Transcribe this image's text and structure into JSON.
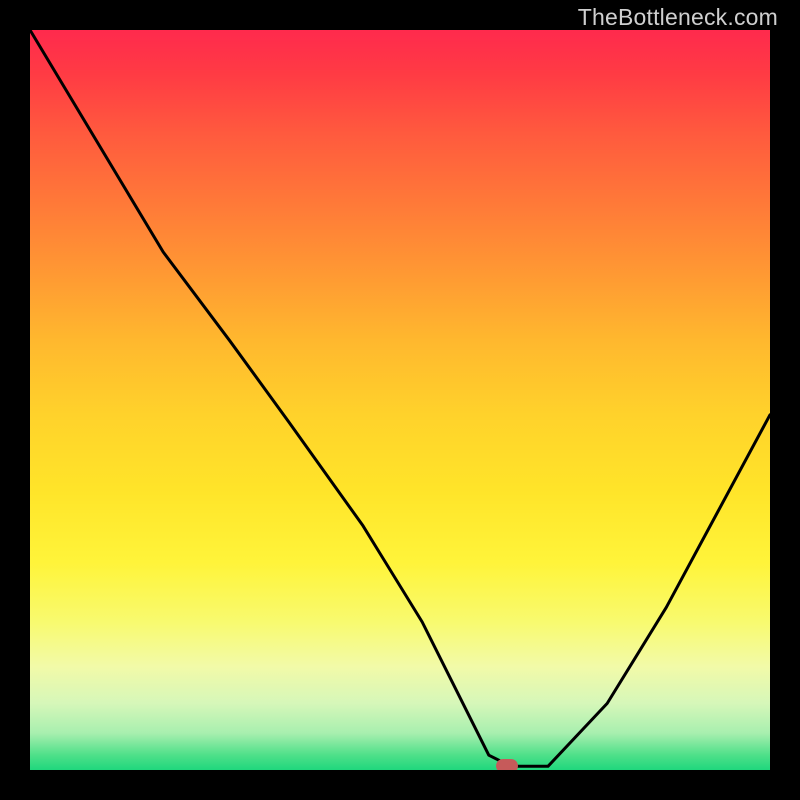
{
  "watermark": "TheBottleneck.com",
  "colors": {
    "frame": "#000000",
    "marker": "#c65a5a",
    "curve": "#000000"
  },
  "chart_data": {
    "type": "line",
    "x": [
      0.0,
      0.06,
      0.12,
      0.18,
      0.27,
      0.35,
      0.45,
      0.53,
      0.57,
      0.6,
      0.62,
      0.65,
      0.7,
      0.78,
      0.86,
      0.93,
      1.0
    ],
    "values": [
      100,
      90,
      80,
      70,
      58,
      47,
      33,
      20,
      12,
      6,
      2,
      0.5,
      0.5,
      9,
      22,
      35,
      48
    ],
    "title": "",
    "xlabel": "",
    "ylabel": "",
    "xlim": [
      0,
      1
    ],
    "ylim": [
      0,
      100
    ],
    "marker": {
      "x": 0.645,
      "y": 0.5
    },
    "grid": false,
    "legend": false
  }
}
